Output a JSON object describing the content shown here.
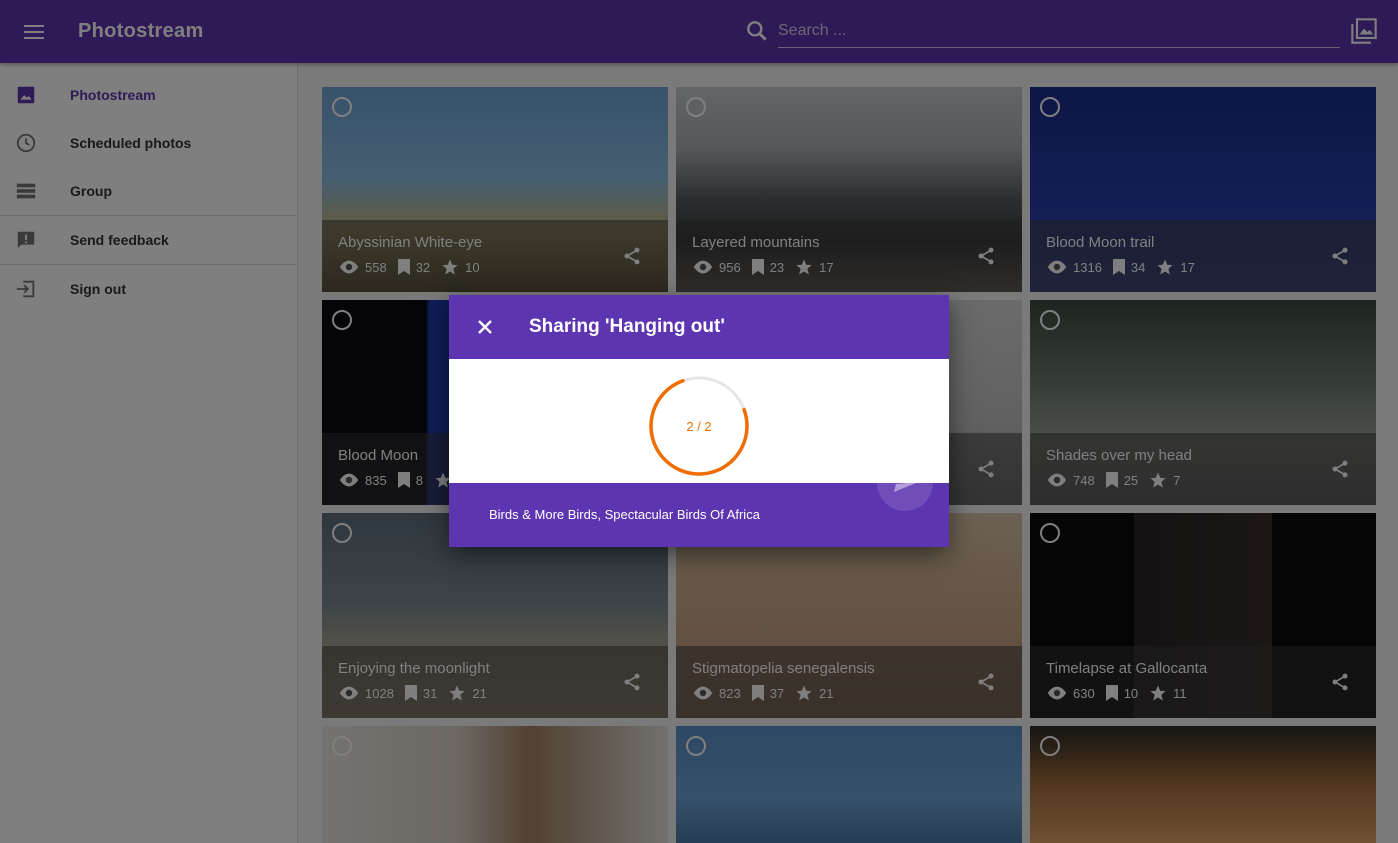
{
  "app": {
    "title": "Photostream"
  },
  "search": {
    "placeholder": "Search ..."
  },
  "sidebar": {
    "items": [
      {
        "label": "Photostream",
        "icon": "image-icon",
        "active": true
      },
      {
        "label": "Scheduled photos",
        "icon": "clock-icon"
      },
      {
        "label": "Group",
        "icon": "group-icon"
      },
      {
        "label": "Send feedback",
        "icon": "feedback-icon"
      },
      {
        "label": "Sign out",
        "icon": "sign-out-icon"
      }
    ]
  },
  "photos": [
    {
      "title": "Abyssinian White-eye",
      "views": "558",
      "saves": "32",
      "stars": "10"
    },
    {
      "title": "Layered mountains",
      "views": "956",
      "saves": "23",
      "stars": "17"
    },
    {
      "title": "Blood Moon trail",
      "views": "1316",
      "saves": "34",
      "stars": "17"
    },
    {
      "title": "Blood Moon",
      "views": "835",
      "saves": "8",
      "stars": ""
    },
    {
      "title": "",
      "views": "",
      "saves": "",
      "stars": ""
    },
    {
      "title": "Shades over my head",
      "views": "748",
      "saves": "25",
      "stars": "7"
    },
    {
      "title": "Enjoying the moonlight",
      "views": "1028",
      "saves": "31",
      "stars": "21"
    },
    {
      "title": "Stigmatopelia senegalensis",
      "views": "823",
      "saves": "37",
      "stars": "21"
    },
    {
      "title": "Timelapse at Gallocanta",
      "views": "630",
      "saves": "10",
      "stars": "11"
    },
    {
      "title": "",
      "views": "",
      "saves": "",
      "stars": ""
    },
    {
      "title": "",
      "views": "",
      "saves": "",
      "stars": ""
    },
    {
      "title": "",
      "views": "",
      "saves": "",
      "stars": ""
    }
  ],
  "dialog": {
    "title": "Sharing 'Hanging out'",
    "progress_text": "2 / 2",
    "progress_fraction": 0.75,
    "groups": "Birds & More Birds, Spectacular Birds Of Africa"
  },
  "colors": {
    "primary": "#5e35b1",
    "accent": "#ef6c00"
  }
}
